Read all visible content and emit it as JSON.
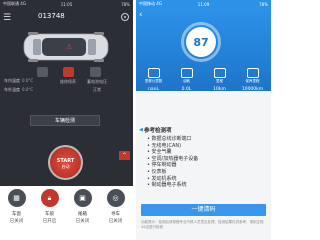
{
  "left": {
    "status": {
      "signal": "中国联通 4G",
      "time": "11:05",
      "battery": "78%"
    },
    "plate": "013748",
    "plate_sub": "苏E...",
    "doors": {
      "front_left": "左前",
      "front_right": "右前",
      "rear_left": "左后",
      "rear_right": "右后"
    },
    "stats": [
      {
        "label": "车内温度",
        "value": "0.0°C"
      },
      {
        "label": "车外温度",
        "value": "0.0°C"
      }
    ],
    "icon_caps": {
      "maintenance": "维修保养",
      "battery_voltage": "蓄电池电压",
      "battery_status": "正常"
    },
    "check_button": "车辆检测",
    "start": {
      "line1": "START",
      "line2": "启动"
    },
    "controls": [
      {
        "name": "车窗",
        "state": "已关闭"
      },
      {
        "name": "车锁",
        "state": "已开启"
      },
      {
        "name": "尾箱",
        "state": "已关闭"
      },
      {
        "name": "寻车",
        "state": "已关闭"
      }
    ]
  },
  "right": {
    "status": {
      "signal": "中国移动 4G",
      "time": "11:09",
      "battery": "78%"
    },
    "score": "87",
    "metrics": [
      {
        "label": "里程公里数",
        "value": "nanL"
      },
      {
        "label": "油耗",
        "value": "0.0L"
      },
      {
        "label": "里程",
        "value": "10km"
      },
      {
        "label": "保养里程",
        "value": "10000km"
      }
    ],
    "panel_title": "参考检测项",
    "items": [
      "数据总线诊断端口",
      "无线电(CAN)",
      "安全气囊",
      "空调/加热器电子设备",
      "停车制动器",
      "仪表板",
      "发动机系统",
      "制动器电子系统"
    ],
    "onekey": "一键清码",
    "footnote": "功能提示：检测后请按照专业汽修人员意见处理，检测结果仅供参考，请到正规4S店进行检修"
  }
}
